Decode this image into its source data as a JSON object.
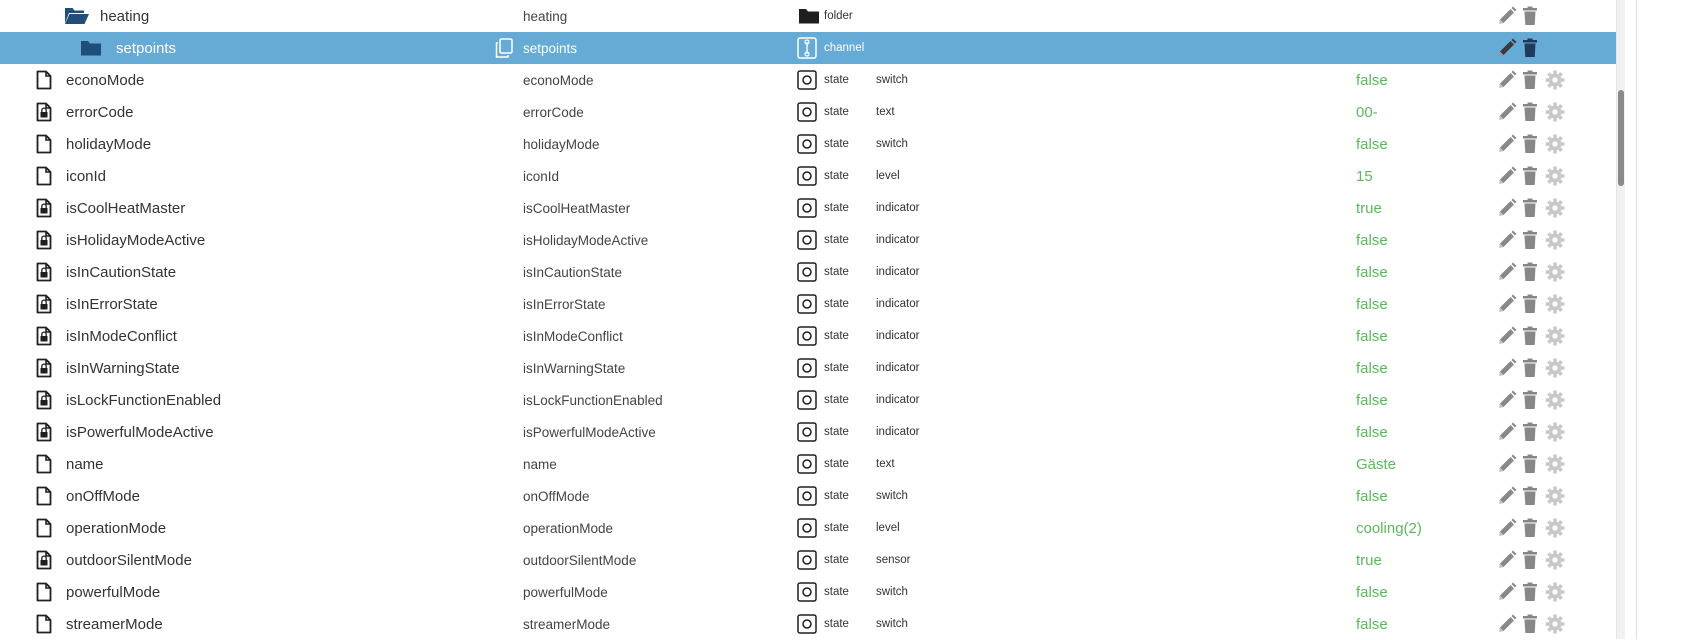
{
  "colors": {
    "selected_row": "#66aad6",
    "value_green": "#5cb85c",
    "icon_dark": "#1f1f1f",
    "folder_blue": "#1f4e79",
    "action_gray": "#888888",
    "gear_gray": "#c8c8c8"
  },
  "rows": [
    {
      "name": "heating",
      "id": "heating",
      "type": "folder",
      "role": "",
      "value": "",
      "icon": "folder-open-icon",
      "type_icon": "folder-icon",
      "level": 1,
      "selected": false,
      "gear": false
    },
    {
      "name": "setpoints",
      "id": "setpoints",
      "type": "channel",
      "role": "",
      "value": "",
      "icon": "folder-icon",
      "type_icon": "channel-icon",
      "level": 2,
      "selected": true,
      "gear": false,
      "copy": true
    },
    {
      "name": "econoMode",
      "id": "econoMode",
      "type": "state",
      "role": "switch",
      "value": "false",
      "icon": "file-icon",
      "type_icon": "state-icon",
      "level": 0,
      "selected": false,
      "gear": true
    },
    {
      "name": "errorCode",
      "id": "errorCode",
      "type": "state",
      "role": "text",
      "value": "00-",
      "icon": "file-lock-icon",
      "type_icon": "state-icon",
      "level": 0,
      "selected": false,
      "gear": true
    },
    {
      "name": "holidayMode",
      "id": "holidayMode",
      "type": "state",
      "role": "switch",
      "value": "false",
      "icon": "file-icon",
      "type_icon": "state-icon",
      "level": 0,
      "selected": false,
      "gear": true
    },
    {
      "name": "iconId",
      "id": "iconId",
      "type": "state",
      "role": "level",
      "value": "15",
      "icon": "file-icon",
      "type_icon": "state-icon",
      "level": 0,
      "selected": false,
      "gear": true
    },
    {
      "name": "isCoolHeatMaster",
      "id": "isCoolHeatMaster",
      "type": "state",
      "role": "indicator",
      "value": "true",
      "icon": "file-lock-icon",
      "type_icon": "state-icon",
      "level": 0,
      "selected": false,
      "gear": true
    },
    {
      "name": "isHolidayModeActive",
      "id": "isHolidayModeActive",
      "type": "state",
      "role": "indicator",
      "value": "false",
      "icon": "file-lock-icon",
      "type_icon": "state-icon",
      "level": 0,
      "selected": false,
      "gear": true
    },
    {
      "name": "isInCautionState",
      "id": "isInCautionState",
      "type": "state",
      "role": "indicator",
      "value": "false",
      "icon": "file-lock-icon",
      "type_icon": "state-icon",
      "level": 0,
      "selected": false,
      "gear": true
    },
    {
      "name": "isInErrorState",
      "id": "isInErrorState",
      "type": "state",
      "role": "indicator",
      "value": "false",
      "icon": "file-lock-icon",
      "type_icon": "state-icon",
      "level": 0,
      "selected": false,
      "gear": true
    },
    {
      "name": "isInModeConflict",
      "id": "isInModeConflict",
      "type": "state",
      "role": "indicator",
      "value": "false",
      "icon": "file-lock-icon",
      "type_icon": "state-icon",
      "level": 0,
      "selected": false,
      "gear": true
    },
    {
      "name": "isInWarningState",
      "id": "isInWarningState",
      "type": "state",
      "role": "indicator",
      "value": "false",
      "icon": "file-lock-icon",
      "type_icon": "state-icon",
      "level": 0,
      "selected": false,
      "gear": true
    },
    {
      "name": "isLockFunctionEnabled",
      "id": "isLockFunctionEnabled",
      "type": "state",
      "role": "indicator",
      "value": "false",
      "icon": "file-lock-icon",
      "type_icon": "state-icon",
      "level": 0,
      "selected": false,
      "gear": true
    },
    {
      "name": "isPowerfulModeActive",
      "id": "isPowerfulModeActive",
      "type": "state",
      "role": "indicator",
      "value": "false",
      "icon": "file-lock-icon",
      "type_icon": "state-icon",
      "level": 0,
      "selected": false,
      "gear": true
    },
    {
      "name": "name",
      "id": "name",
      "type": "state",
      "role": "text",
      "value": "Gäste",
      "icon": "file-icon",
      "type_icon": "state-icon",
      "level": 0,
      "selected": false,
      "gear": true
    },
    {
      "name": "onOffMode",
      "id": "onOffMode",
      "type": "state",
      "role": "switch",
      "value": "false",
      "icon": "file-icon",
      "type_icon": "state-icon",
      "level": 0,
      "selected": false,
      "gear": true
    },
    {
      "name": "operationMode",
      "id": "operationMode",
      "type": "state",
      "role": "level",
      "value": "cooling(2)",
      "icon": "file-icon",
      "type_icon": "state-icon",
      "level": 0,
      "selected": false,
      "gear": true
    },
    {
      "name": "outdoorSilentMode",
      "id": "outdoorSilentMode",
      "type": "state",
      "role": "sensor",
      "value": "true",
      "icon": "file-lock-icon",
      "type_icon": "state-icon",
      "level": 0,
      "selected": false,
      "gear": true
    },
    {
      "name": "powerfulMode",
      "id": "powerfulMode",
      "type": "state",
      "role": "switch",
      "value": "false",
      "icon": "file-icon",
      "type_icon": "state-icon",
      "level": 0,
      "selected": false,
      "gear": true
    },
    {
      "name": "streamerMode",
      "id": "streamerMode",
      "type": "state",
      "role": "switch",
      "value": "false",
      "icon": "file-icon",
      "type_icon": "state-icon",
      "level": 0,
      "selected": false,
      "gear": true
    }
  ]
}
